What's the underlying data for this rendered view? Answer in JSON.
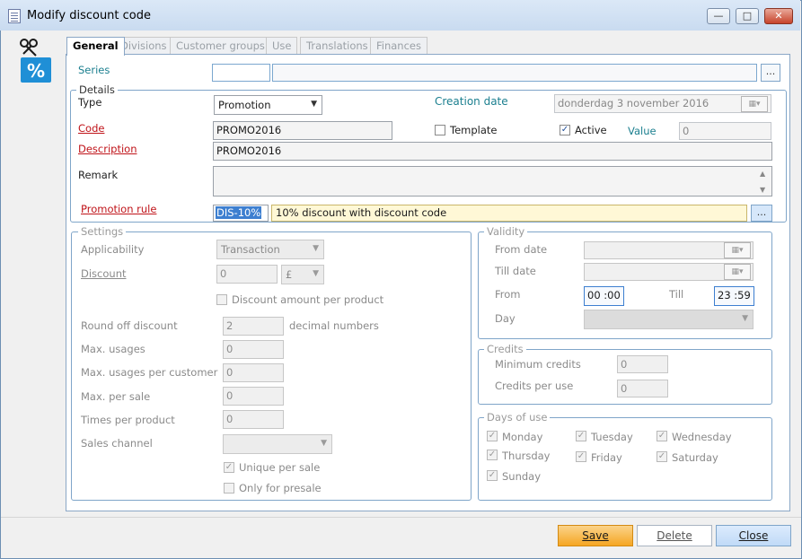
{
  "window": {
    "title": "Modify discount code"
  },
  "tabs": [
    {
      "label": "General",
      "active": true
    },
    {
      "label": "Divisions"
    },
    {
      "label": "Customer groups"
    },
    {
      "label": "Use"
    },
    {
      "label": "Translations"
    },
    {
      "label": "Finances"
    }
  ],
  "series": {
    "label": "Series",
    "code": "",
    "name": "",
    "btn": "..."
  },
  "details": {
    "title": "Details",
    "type_label": "Type",
    "type_value": "Promotion",
    "creation_date_label": "Creation date",
    "creation_date_value": "donderdag 3 november 2016",
    "code_label": "Code",
    "code_value": "PROMO2016",
    "template_label": "Template",
    "template_checked": false,
    "active_label": "Active",
    "active_checked": true,
    "value_label": "Value",
    "value_value": "0",
    "description_label": "Description",
    "description_value": "PROMO2016",
    "remark_label": "Remark",
    "remark_value": "",
    "promotion_rule_label": "Promotion rule",
    "promotion_rule_code": "DIS-10%",
    "promotion_rule_desc": "10% discount with discount code",
    "promotion_rule_btn": "..."
  },
  "settings": {
    "title": "Settings",
    "applicability_label": "Applicability",
    "applicability_value": "Transaction",
    "discount_label": "Discount",
    "discount_value": "0",
    "currency_value": "£",
    "discount_per_product_label": "Discount amount per product",
    "round_off_label": "Round off discount",
    "round_off_value": "2",
    "decimal_label": "decimal numbers",
    "max_usages_label": "Max. usages",
    "max_usages_value": "0",
    "max_usages_customer_label": "Max. usages per customer",
    "max_usages_customer_value": "0",
    "max_per_sale_label": "Max. per sale",
    "max_per_sale_value": "0",
    "times_per_product_label": "Times per product",
    "times_per_product_value": "0",
    "sales_channel_label": "Sales channel",
    "sales_channel_value": "",
    "unique_per_sale_label": "Unique per sale",
    "only_presale_label": "Only for presale"
  },
  "validity": {
    "title": "Validity",
    "from_date_label": "From date",
    "till_date_label": "Till date",
    "from_label": "From",
    "from_value": "00 :00",
    "till_label": "Till",
    "till_value": "23 :59",
    "day_label": "Day"
  },
  "credits": {
    "title": "Credits",
    "minimum_label": "Minimum credits",
    "minimum_value": "0",
    "per_use_label": "Credits per use",
    "per_use_value": "0"
  },
  "days": {
    "title": "Days of use",
    "monday": "Monday",
    "tuesday": "Tuesday",
    "wednesday": "Wednesday",
    "thursday": "Thursday",
    "friday": "Friday",
    "saturday": "Saturday",
    "sunday": "Sunday"
  },
  "footer": {
    "save": "Save",
    "delete": "Delete",
    "close": "Close"
  },
  "colors": {
    "accent": "#1b7f8f",
    "required": "#c0141a",
    "save": "#f5a623",
    "highlight": "#3d7fd0"
  }
}
